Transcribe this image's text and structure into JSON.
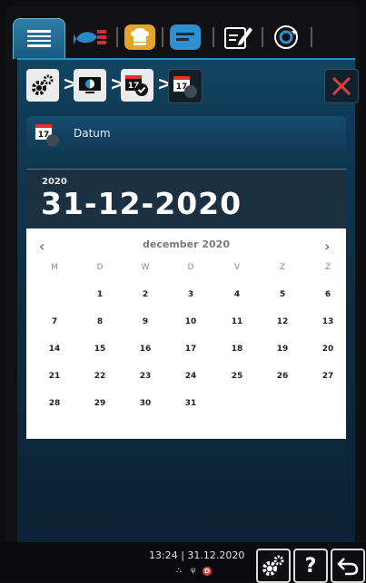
{
  "section": {
    "label": "Datum"
  },
  "datepicker": {
    "year": "2020",
    "selected_date": "31-12-2020",
    "month_label": "december 2020",
    "prev_label": "‹",
    "next_label": "›",
    "weekdays": [
      "M",
      "D",
      "W",
      "D",
      "V",
      "Z",
      "Z"
    ],
    "weeks": [
      [
        "",
        "1",
        "2",
        "3",
        "4",
        "5",
        "6"
      ],
      [
        "7",
        "8",
        "9",
        "10",
        "11",
        "12",
        "13"
      ],
      [
        "14",
        "15",
        "16",
        "17",
        "18",
        "19",
        "20"
      ],
      [
        "21",
        "22",
        "23",
        "24",
        "25",
        "26",
        "27"
      ],
      [
        "28",
        "29",
        "30",
        "31",
        "",
        "",
        ""
      ]
    ]
  },
  "calendar_icon_number": "17",
  "status": {
    "clock": "13:24 | 31.12.2020",
    "indicator_d": "D",
    "help_label": "?"
  },
  "colors": {
    "accent": "#2f89b9",
    "close": "#e23b3b",
    "panel": "#0f3a55"
  },
  "icons": {
    "tab_menu": "menu-icon",
    "tab_2": "fish-drop-icon",
    "tab_3": "chef-hat-icon",
    "tab_4": "tray-icon",
    "tab_5": "edit-icon",
    "tab_6": "cloud-icon",
    "crumb_1": "gear-icon",
    "crumb_2": "monitor-icon",
    "crumb_3": "calendar-check-icon",
    "crumb_4": "calendar-clock-icon",
    "close": "close-icon",
    "back": "back-arrow-icon"
  }
}
